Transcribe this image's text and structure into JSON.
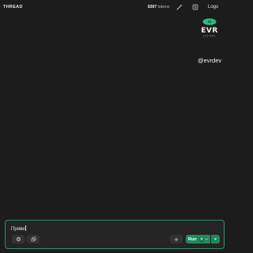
{
  "header": {
    "title": "THREAD",
    "tokens_count": "8397",
    "tokens_label": "tokens",
    "logs_label": "Logs",
    "wand_icon": "magic-wand-icon",
    "settings_icon": "sliders-icon"
  },
  "brand": {
    "handle": "@evrdev",
    "logo_text": "EVR",
    "logo_subtext": "SYSTEMS",
    "badge_text": "AI"
  },
  "composer": {
    "input_value": "Приве",
    "attach_icon": "paperclip-icon",
    "copy_icon": "copy-icon",
    "add_icon": "plus-icon",
    "run_label": "Run",
    "run_shortcut_mod": "⌘",
    "run_shortcut_key": "↵",
    "dropdown_icon": "chevron-down-icon"
  },
  "colors": {
    "background": "#1c1c1c",
    "accent": "#1e8a5e",
    "composer_border": "#2f8f6a"
  }
}
